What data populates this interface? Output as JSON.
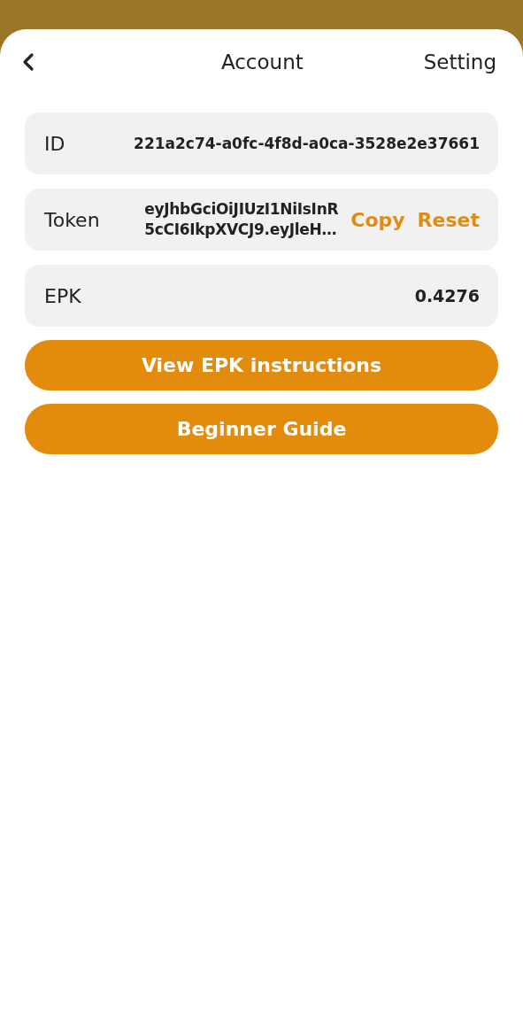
{
  "header": {
    "title": "Account",
    "action": "Setting"
  },
  "rows": [
    {
      "kind": "plain",
      "label": "ID",
      "value": "221a2c74-a0fc-4f8d-a0ca-3528e2e37661"
    },
    {
      "kind": "token",
      "label": "Token",
      "value_lines": [
        "eyJhbGciOiJIUzI1NiIsInR",
        "5cCI6IkpXVCJ9.eyJleH…"
      ],
      "actions": [
        "Copy",
        "Reset"
      ]
    },
    {
      "kind": "plain",
      "label": "EPK",
      "value": "0.4276"
    }
  ],
  "buttons": [
    "View EPK instructions",
    "Beginner Guide"
  ]
}
